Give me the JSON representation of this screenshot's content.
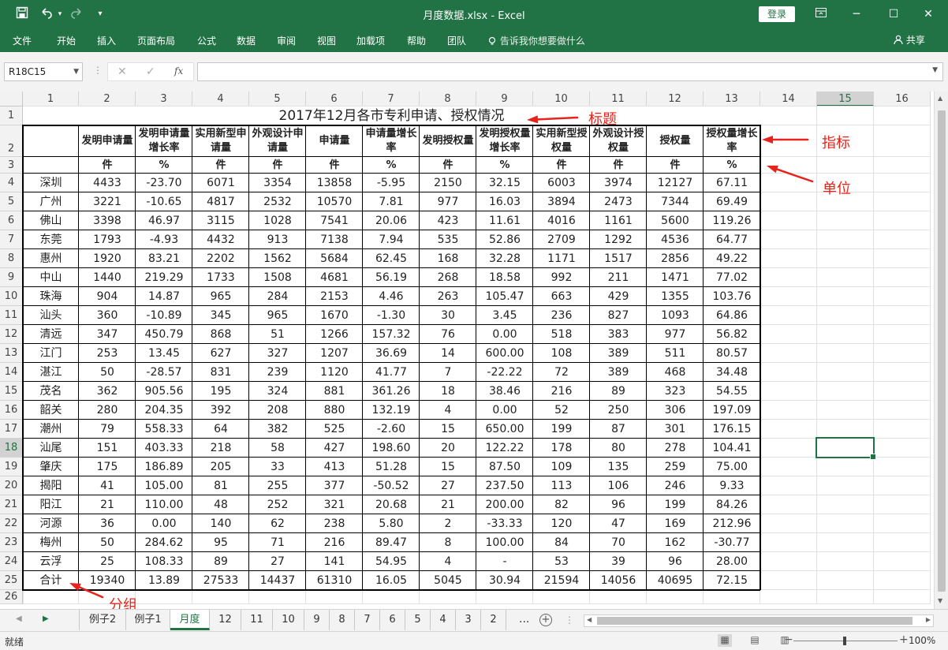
{
  "window": {
    "title": "月度数据.xlsx  -  Excel",
    "login_label": "登录",
    "qat": {
      "save_icon": "save-icon",
      "undo_icon": "undo-icon",
      "redo_icon": "redo-icon"
    }
  },
  "ribbon": {
    "tabs": [
      "文件",
      "开始",
      "插入",
      "页面布局",
      "公式",
      "数据",
      "审阅",
      "视图",
      "加载项",
      "帮助",
      "团队"
    ],
    "tell_me": "告诉我你想要做什么",
    "share": "共享"
  },
  "formula_bar": {
    "name_box": "R18C15",
    "fx": "fx",
    "value": ""
  },
  "sheet": {
    "column_headers": [
      "1",
      "2",
      "3",
      "4",
      "5",
      "6",
      "7",
      "8",
      "9",
      "10",
      "11",
      "12",
      "13",
      "14",
      "15",
      "16"
    ],
    "row_headers": [
      "1",
      "2",
      "3",
      "4",
      "5",
      "6",
      "7",
      "8",
      "9",
      "10",
      "11",
      "12",
      "13",
      "14",
      "15",
      "16",
      "17",
      "18",
      "19",
      "20",
      "21",
      "22",
      "23",
      "24",
      "25",
      "26"
    ],
    "selected_column": "15",
    "selected_row": "18",
    "title": "2017年12月各市专利申请、授权情况",
    "indicators": [
      "发明申请量",
      "发明申请量增长率",
      "实用新型申请量",
      "外观设计申请量",
      "申请量",
      "申请量增长率",
      "发明授权量",
      "发明授权量增长率",
      "实用新型授权量",
      "外观设计授权量",
      "授权量",
      "授权量增长率"
    ],
    "units": [
      "件",
      "%",
      "件",
      "件",
      "件",
      "%",
      "件",
      "%",
      "件",
      "件",
      "件",
      "%"
    ],
    "rows": [
      [
        "深圳",
        "4433",
        "-23.70",
        "6071",
        "3354",
        "13858",
        "-5.95",
        "2150",
        "32.15",
        "6003",
        "3974",
        "12127",
        "67.11"
      ],
      [
        "广州",
        "3221",
        "-10.65",
        "4817",
        "2532",
        "10570",
        "7.81",
        "977",
        "16.03",
        "3894",
        "2473",
        "7344",
        "69.49"
      ],
      [
        "佛山",
        "3398",
        "46.97",
        "3115",
        "1028",
        "7541",
        "20.06",
        "423",
        "11.61",
        "4016",
        "1161",
        "5600",
        "119.26"
      ],
      [
        "东莞",
        "1793",
        "-4.93",
        "4432",
        "913",
        "7138",
        "7.94",
        "535",
        "52.86",
        "2709",
        "1292",
        "4536",
        "64.77"
      ],
      [
        "惠州",
        "1920",
        "83.21",
        "2202",
        "1562",
        "5684",
        "62.45",
        "168",
        "32.28",
        "1171",
        "1517",
        "2856",
        "49.22"
      ],
      [
        "中山",
        "1440",
        "219.29",
        "1733",
        "1508",
        "4681",
        "56.19",
        "268",
        "18.58",
        "992",
        "211",
        "1471",
        "77.02"
      ],
      [
        "珠海",
        "904",
        "14.87",
        "965",
        "284",
        "2153",
        "4.46",
        "263",
        "105.47",
        "663",
        "429",
        "1355",
        "103.76"
      ],
      [
        "汕头",
        "360",
        "-10.89",
        "345",
        "965",
        "1670",
        "-1.30",
        "30",
        "3.45",
        "236",
        "827",
        "1093",
        "64.86"
      ],
      [
        "清远",
        "347",
        "450.79",
        "868",
        "51",
        "1266",
        "157.32",
        "76",
        "0.00",
        "518",
        "383",
        "977",
        "56.82"
      ],
      [
        "江门",
        "253",
        "13.45",
        "627",
        "327",
        "1207",
        "36.69",
        "14",
        "600.00",
        "108",
        "389",
        "511",
        "80.57"
      ],
      [
        "湛江",
        "50",
        "-28.57",
        "831",
        "239",
        "1120",
        "41.77",
        "7",
        "-22.22",
        "72",
        "389",
        "468",
        "34.48"
      ],
      [
        "茂名",
        "362",
        "905.56",
        "195",
        "324",
        "881",
        "361.26",
        "18",
        "38.46",
        "216",
        "89",
        "323",
        "54.55"
      ],
      [
        "韶关",
        "280",
        "204.35",
        "392",
        "208",
        "880",
        "132.19",
        "4",
        "0.00",
        "52",
        "250",
        "306",
        "197.09"
      ],
      [
        "潮州",
        "79",
        "558.33",
        "64",
        "382",
        "525",
        "-2.60",
        "15",
        "650.00",
        "199",
        "87",
        "301",
        "176.15"
      ],
      [
        "汕尾",
        "151",
        "403.33",
        "218",
        "58",
        "427",
        "198.60",
        "20",
        "122.22",
        "178",
        "80",
        "278",
        "104.41"
      ],
      [
        "肇庆",
        "175",
        "186.89",
        "205",
        "33",
        "413",
        "51.28",
        "15",
        "87.50",
        "109",
        "135",
        "259",
        "75.00"
      ],
      [
        "揭阳",
        "41",
        "105.00",
        "81",
        "255",
        "377",
        "-50.52",
        "27",
        "237.50",
        "113",
        "106",
        "246",
        "9.33"
      ],
      [
        "阳江",
        "21",
        "110.00",
        "48",
        "252",
        "321",
        "20.68",
        "21",
        "200.00",
        "82",
        "96",
        "199",
        "84.26"
      ],
      [
        "河源",
        "36",
        "0.00",
        "140",
        "62",
        "238",
        "5.80",
        "2",
        "-33.33",
        "120",
        "47",
        "169",
        "212.96"
      ],
      [
        "梅州",
        "50",
        "284.62",
        "95",
        "71",
        "216",
        "89.47",
        "8",
        "100.00",
        "84",
        "70",
        "162",
        "-30.77"
      ],
      [
        "云浮",
        "25",
        "108.33",
        "89",
        "27",
        "141",
        "54.95",
        "4",
        "-",
        "53",
        "39",
        "96",
        "28.00"
      ],
      [
        "合计",
        "19340",
        "13.89",
        "27533",
        "14437",
        "61310",
        "16.05",
        "5045",
        "30.94",
        "21594",
        "14056",
        "40695",
        "72.15"
      ]
    ],
    "annotations": {
      "title": "标题",
      "indicators": "指标",
      "unit": "单位",
      "group": "分组"
    },
    "annotation_color": "#e8231b"
  },
  "sheet_tabs": {
    "tabs": [
      "例子2",
      "例子1",
      "月度",
      "12",
      "11",
      "10",
      "9",
      "8",
      "7",
      "6",
      "5",
      "4",
      "3",
      "2"
    ],
    "active": "月度",
    "more": "...",
    "add": "+"
  },
  "status": {
    "ready": "就绪",
    "zoom": "100%"
  },
  "colors": {
    "excel_green": "#217346",
    "header_gray": "#f2f2f2"
  }
}
